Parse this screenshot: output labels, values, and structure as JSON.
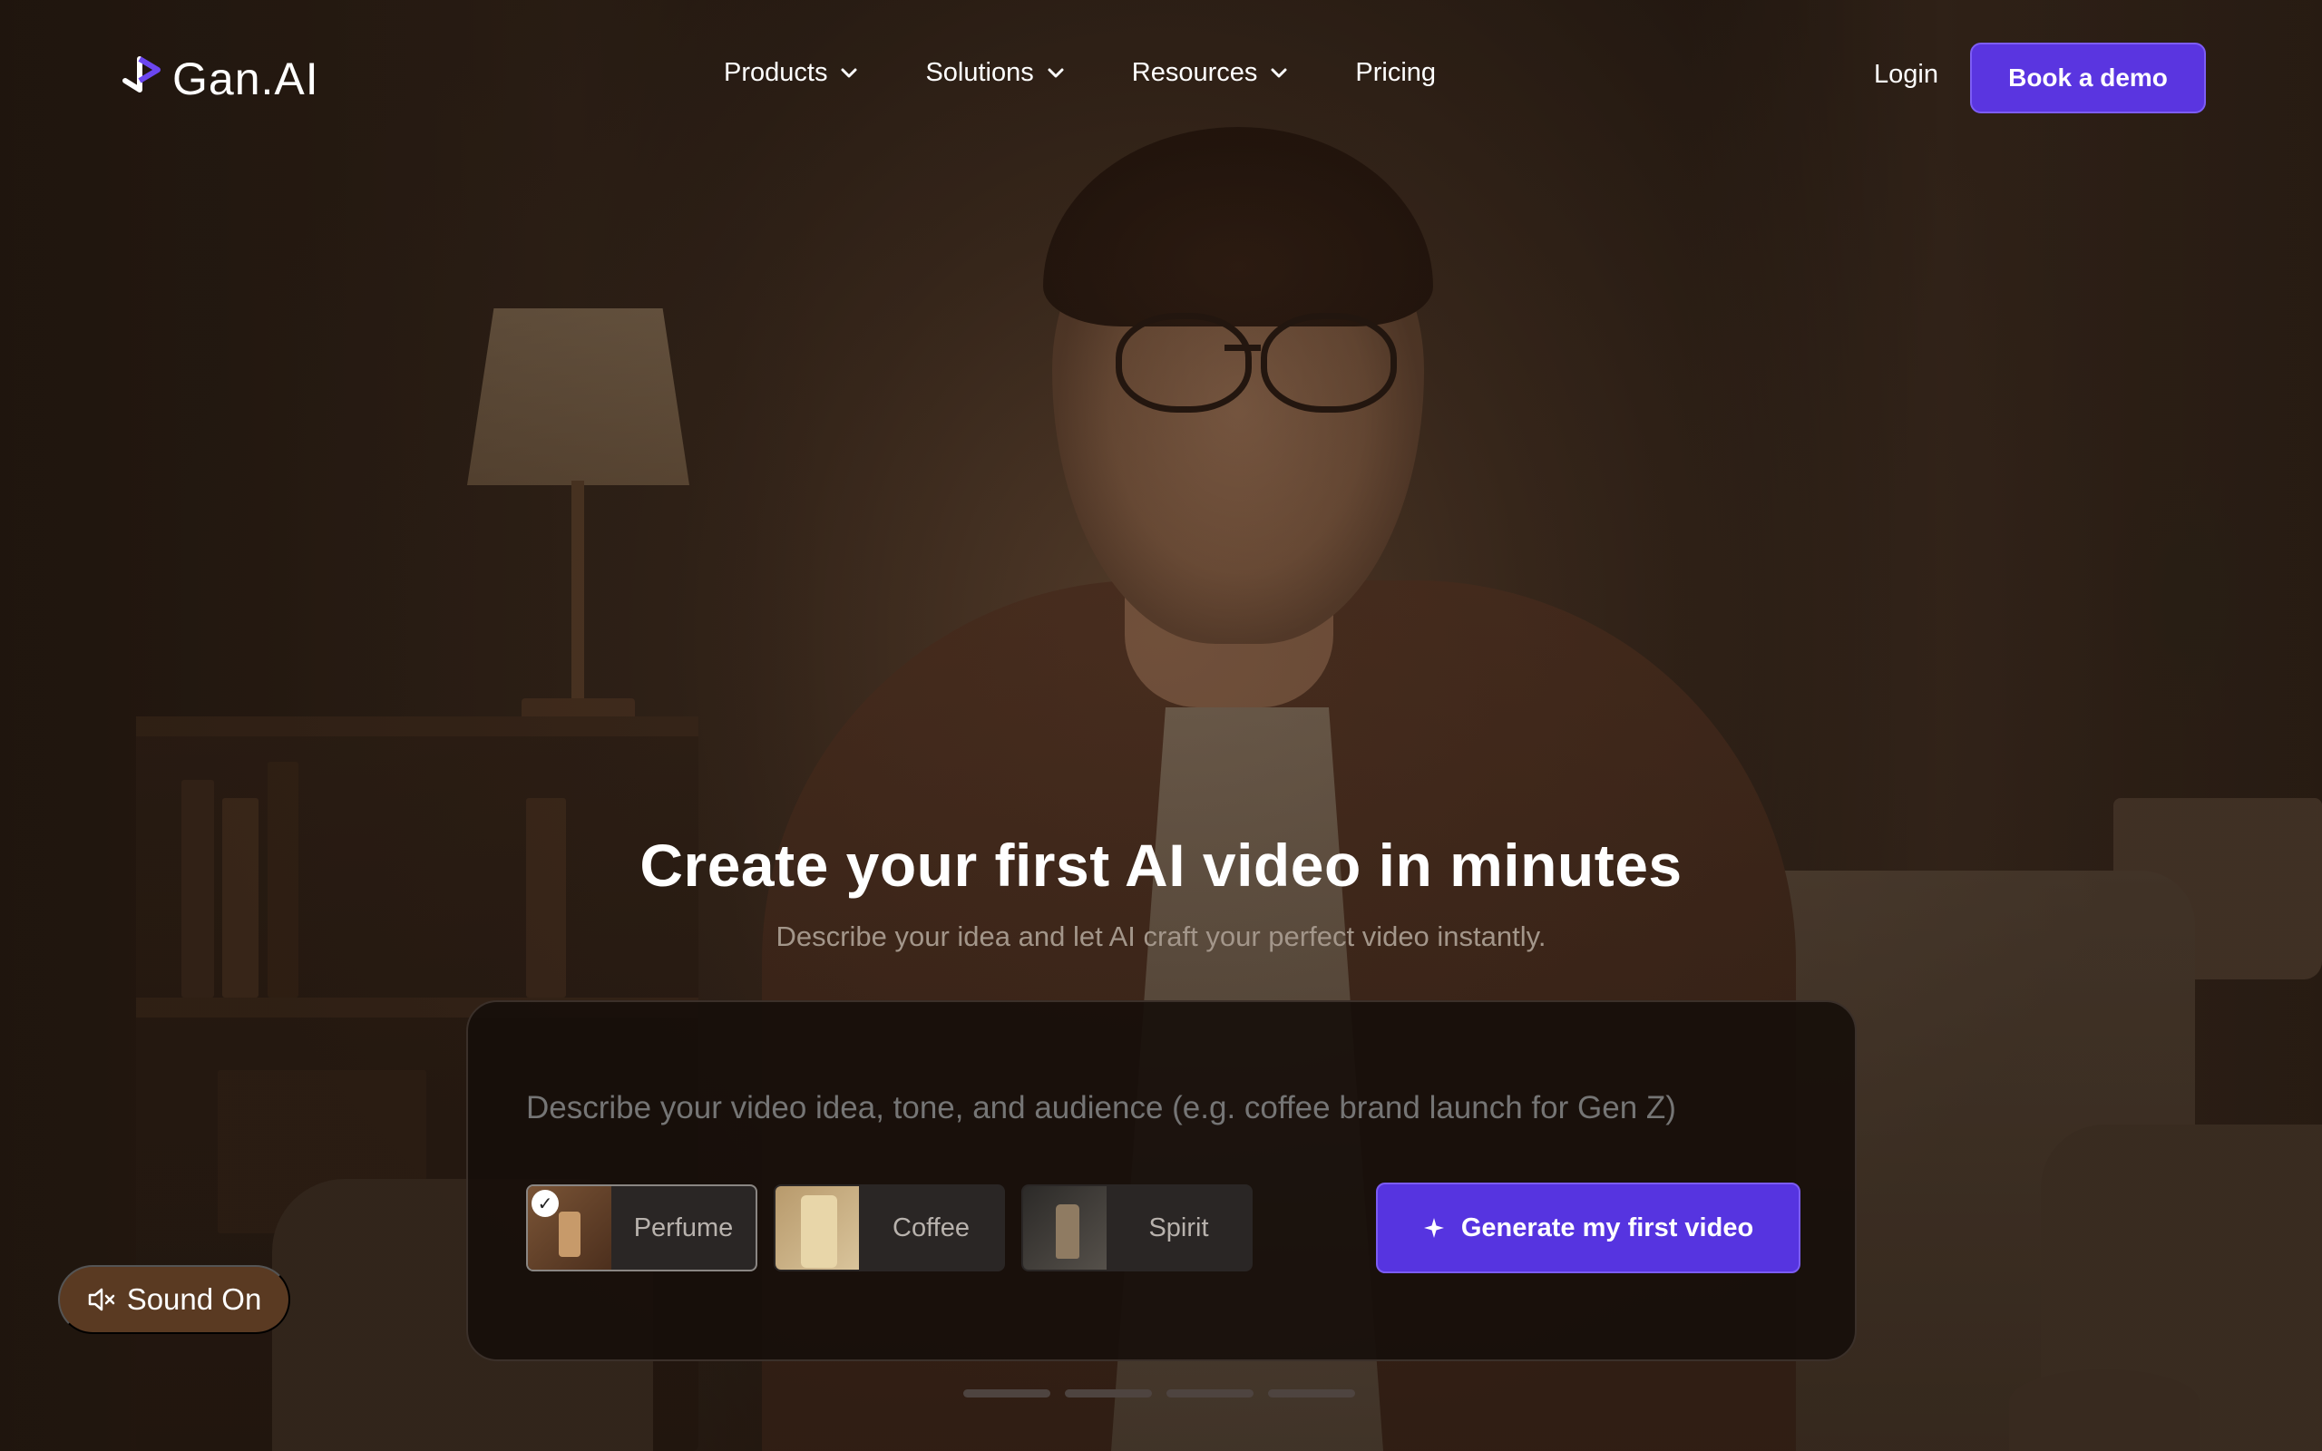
{
  "brand": {
    "name": "Gan.AI"
  },
  "nav": {
    "items": [
      {
        "label": "Products",
        "has_dropdown": true
      },
      {
        "label": "Solutions",
        "has_dropdown": true
      },
      {
        "label": "Resources",
        "has_dropdown": true
      },
      {
        "label": "Pricing",
        "has_dropdown": false
      }
    ],
    "login_label": "Login",
    "demo_label": "Book a demo"
  },
  "hero": {
    "title": "Create your first AI video in minutes",
    "subtitle": "Describe your idea and let AI craft your perfect video instantly."
  },
  "prompt_card": {
    "placeholder": "Describe your video idea, tone, and audience (e.g. coffee brand launch for Gen Z)",
    "presets": [
      {
        "label": "Perfume",
        "selected": true,
        "icon": "perfume-thumbnail"
      },
      {
        "label": "Coffee",
        "selected": false,
        "icon": "coffee-thumbnail"
      },
      {
        "label": "Spirit",
        "selected": false,
        "icon": "spirit-thumbnail"
      }
    ],
    "generate_label": "Generate my first video",
    "generate_icon": "sparkle-icon"
  },
  "carousel": {
    "slide_count": 4
  },
  "sound": {
    "label": "Sound On",
    "icon": "speaker-muted-icon"
  },
  "colors": {
    "accent": "#5634e0",
    "accent_border": "#7b5cf3",
    "sound_button": "#5a3a22"
  }
}
